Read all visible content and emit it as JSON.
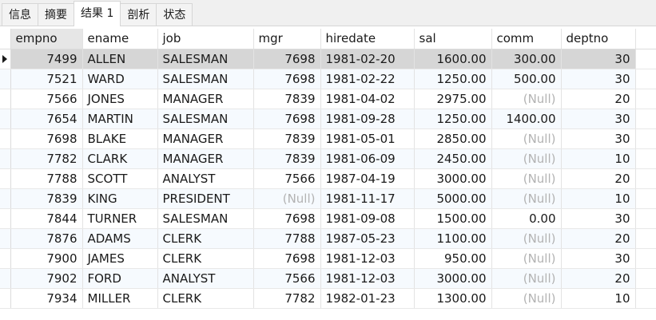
{
  "tabs": [
    {
      "label": "信息"
    },
    {
      "label": "摘要"
    },
    {
      "label": "结果 1"
    },
    {
      "label": "剖析"
    },
    {
      "label": "状态"
    }
  ],
  "grid": {
    "columns": [
      {
        "name": "empno",
        "align": "num"
      },
      {
        "name": "ename",
        "align": "text"
      },
      {
        "name": "job",
        "align": "text"
      },
      {
        "name": "mgr",
        "align": "num"
      },
      {
        "name": "hiredate",
        "align": "text"
      },
      {
        "name": "sal",
        "align": "num"
      },
      {
        "name": "comm",
        "align": "num"
      },
      {
        "name": "deptno",
        "align": "num"
      }
    ],
    "null_text": "(Null)",
    "rows": [
      [
        "7499",
        "ALLEN",
        "SALESMAN",
        "7698",
        "1981-02-20",
        "1600.00",
        "300.00",
        "30"
      ],
      [
        "7521",
        "WARD",
        "SALESMAN",
        "7698",
        "1981-02-22",
        "1250.00",
        "500.00",
        "30"
      ],
      [
        "7566",
        "JONES",
        "MANAGER",
        "7839",
        "1981-04-02",
        "2975.00",
        null,
        "20"
      ],
      [
        "7654",
        "MARTIN",
        "SALESMAN",
        "7698",
        "1981-09-28",
        "1250.00",
        "1400.00",
        "30"
      ],
      [
        "7698",
        "BLAKE",
        "MANAGER",
        "7839",
        "1981-05-01",
        "2850.00",
        null,
        "30"
      ],
      [
        "7782",
        "CLARK",
        "MANAGER",
        "7839",
        "1981-06-09",
        "2450.00",
        null,
        "10"
      ],
      [
        "7788",
        "SCOTT",
        "ANALYST",
        "7566",
        "1987-04-19",
        "3000.00",
        null,
        "20"
      ],
      [
        "7839",
        "KING",
        "PRESIDENT",
        null,
        "1981-11-17",
        "5000.00",
        null,
        "10"
      ],
      [
        "7844",
        "TURNER",
        "SALESMAN",
        "7698",
        "1981-09-08",
        "1500.00",
        "0.00",
        "30"
      ],
      [
        "7876",
        "ADAMS",
        "CLERK",
        "7788",
        "1987-05-23",
        "1100.00",
        null,
        "20"
      ],
      [
        "7900",
        "JAMES",
        "CLERK",
        "7698",
        "1981-12-03",
        "950.00",
        null,
        "30"
      ],
      [
        "7902",
        "FORD",
        "ANALYST",
        "7566",
        "1981-12-03",
        "3000.00",
        null,
        "20"
      ],
      [
        "7934",
        "MILLER",
        "CLERK",
        "7782",
        "1982-01-23",
        "1300.00",
        null,
        "10"
      ]
    ],
    "selected_row": 0,
    "selected_column": 0,
    "active_tab": 2
  },
  "colors": {
    "selected_row_bg": "#d6d6d6",
    "alt_row_bg": "#f6fafe",
    "null_text": "#b3b3b3",
    "header_selected_bg": "#e6e6e6"
  },
  "icons": {
    "row_pointer": "row-pointer-icon"
  }
}
